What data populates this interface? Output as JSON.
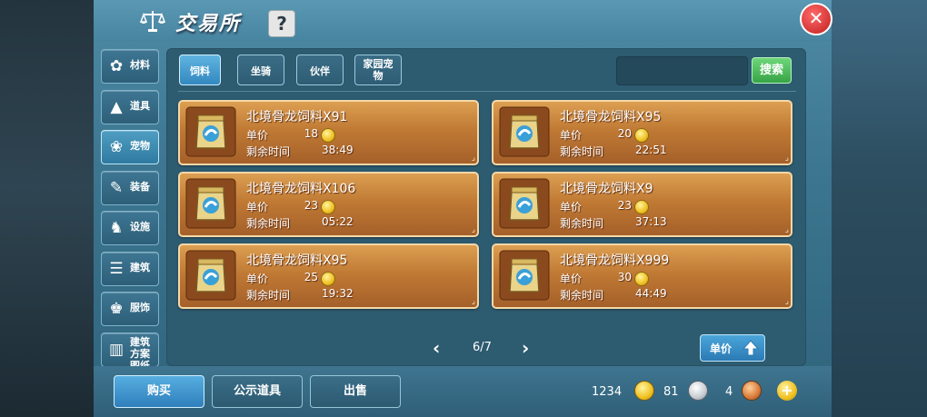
{
  "title": "交易所",
  "help_label": "?",
  "close_label": "✕",
  "sidebar": [
    {
      "label": "材料",
      "icon": "cotton-icon"
    },
    {
      "label": "道具",
      "icon": "potion-icon"
    },
    {
      "label": "宠物",
      "icon": "paw-icon"
    },
    {
      "label": "装备",
      "icon": "sword-icon"
    },
    {
      "label": "设施",
      "icon": "horse-icon"
    },
    {
      "label": "建筑",
      "icon": "building-icon"
    },
    {
      "label": "服饰",
      "icon": "clothes-icon"
    },
    {
      "label": "建筑方案图纸",
      "icon": "blueprint-icon"
    }
  ],
  "tabs": [
    "饲料",
    "坐骑",
    "伙伴",
    "家园宠物"
  ],
  "search_button": "搜索",
  "labels": {
    "price": "单价",
    "time": "剩余时间"
  },
  "items": [
    {
      "name": "北境骨龙饲料X91",
      "price": "18",
      "time": "38:49"
    },
    {
      "name": "北境骨龙饲料X95",
      "price": "20",
      "time": "22:51"
    },
    {
      "name": "北境骨龙饲料X106",
      "price": "23",
      "time": "05:22"
    },
    {
      "name": "北境骨龙饲料X9",
      "price": "23",
      "time": "37:13"
    },
    {
      "name": "北境骨龙饲料X95",
      "price": "25",
      "time": "19:32"
    },
    {
      "name": "北境骨龙饲料X999",
      "price": "30",
      "time": "44:49"
    }
  ],
  "pager": {
    "text": "6/7",
    "prev": "‹",
    "next": "›"
  },
  "sort_button": "单价",
  "bottom": {
    "buy": "购买",
    "public": "公示道具",
    "sell": "出售"
  },
  "currency": {
    "gold": "1234",
    "silver": "81",
    "copper": "4"
  },
  "plus": "+",
  "colors": {
    "card": "#c07a34",
    "accent": "#3388c0",
    "search": "#36a446"
  }
}
